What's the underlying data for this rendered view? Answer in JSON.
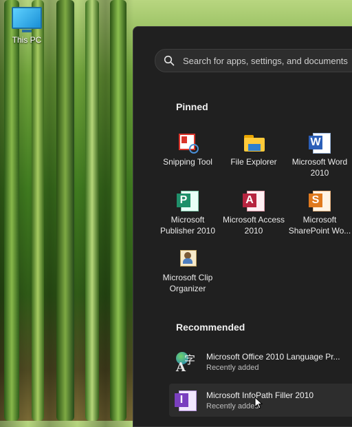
{
  "desktop": {
    "icons": [
      {
        "label": "This PC",
        "icon": "monitor-icon"
      }
    ]
  },
  "start_menu": {
    "search": {
      "placeholder": "Search for apps, settings, and documents"
    },
    "pinned": {
      "title": "Pinned",
      "apps": [
        {
          "line1": "Snipping Tool",
          "line2": "",
          "icon": "scissors-icon"
        },
        {
          "line1": "File Explorer",
          "line2": "",
          "icon": "folder-icon"
        },
        {
          "line1": "Microsoft Word",
          "line2": "2010",
          "icon": "word-icon"
        },
        {
          "line1": "Microsoft",
          "line2": "Publisher 2010",
          "icon": "publisher-icon"
        },
        {
          "line1": "Microsoft Access",
          "line2": "2010",
          "icon": "access-icon"
        },
        {
          "line1": "Microsoft",
          "line2": "SharePoint Wo...",
          "icon": "sharepoint-icon"
        },
        {
          "line1": "Microsoft Clip",
          "line2": "Organizer",
          "icon": "clip-organizer-icon"
        }
      ]
    },
    "recommended": {
      "title": "Recommended",
      "items": [
        {
          "name": "Microsoft Office 2010 Language Pr...",
          "sub": "Recently added",
          "icon": "language-icon"
        },
        {
          "name": "Microsoft InfoPath Filler 2010",
          "sub": "Recently added",
          "icon": "infopath-icon"
        }
      ]
    }
  }
}
